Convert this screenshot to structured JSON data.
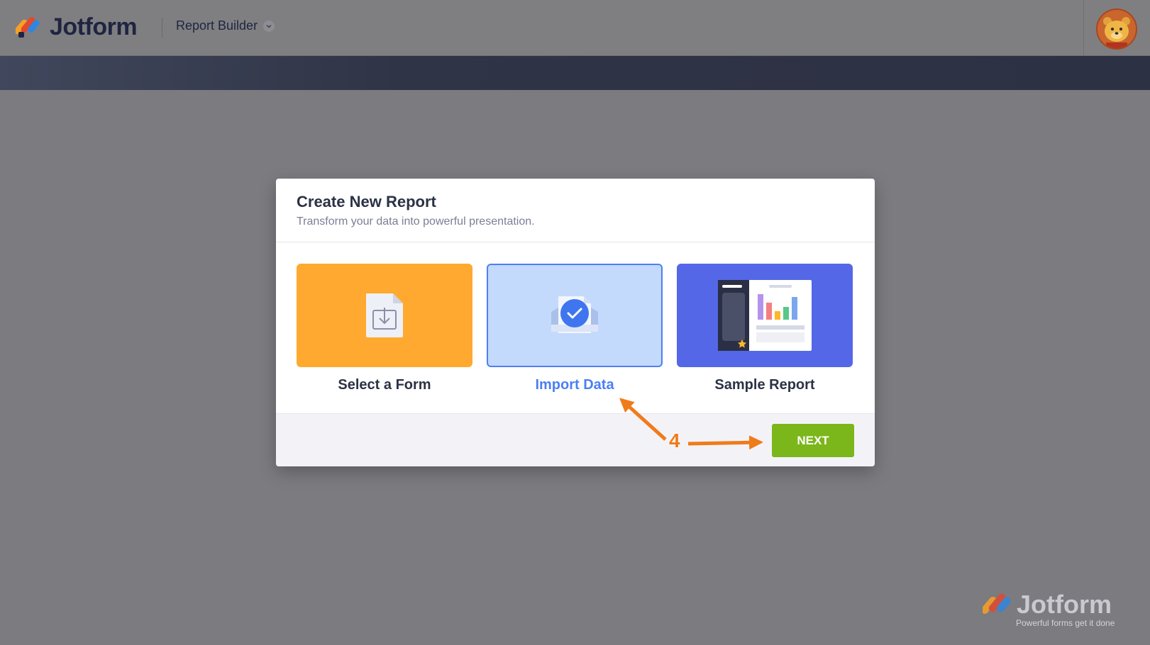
{
  "header": {
    "brand_name": "Jotform",
    "app_name": "Report Builder"
  },
  "modal": {
    "title": "Create New Report",
    "subtitle": "Transform your data into powerful presentation.",
    "options": [
      {
        "label": "Select a Form",
        "icon": "form-download-icon",
        "color": "#ffa930"
      },
      {
        "label": "Import Data",
        "icon": "import-check-icon",
        "color": "#c3dafd",
        "selected": true
      },
      {
        "label": "Sample Report",
        "icon": "sample-report-icon",
        "color": "#5467e6"
      }
    ],
    "next_label": "NEXT"
  },
  "annotation": {
    "step_number": "4"
  },
  "watermark": {
    "name": "Jotform",
    "tagline": "Powerful forms get it done"
  },
  "colors": {
    "accent": "#4b7ff3",
    "next_button": "#7bb61a",
    "arrow": "#f07b1a"
  }
}
